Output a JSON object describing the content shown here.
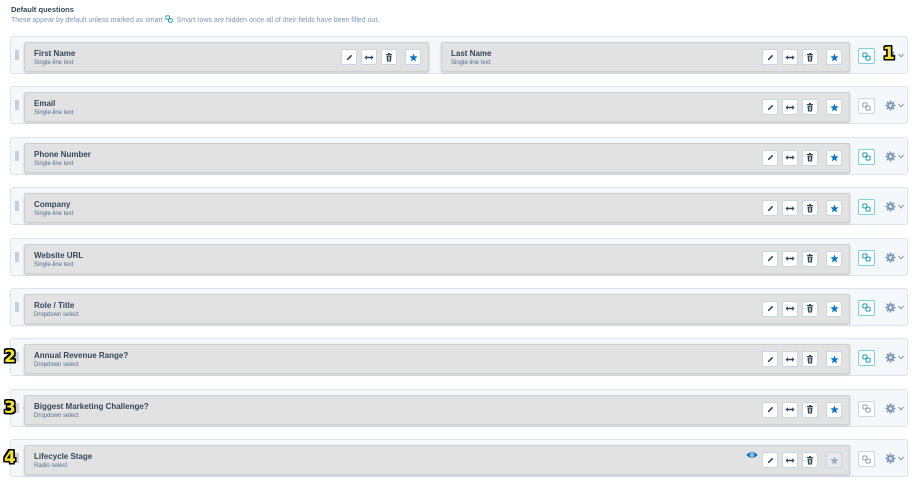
{
  "header": {
    "title": "Default questions",
    "desc_before": "These appear by default unless marked as smart",
    "desc_after": ". Smart rows are hidden once all of their fields have been filled out."
  },
  "colors": {
    "accent": "#0091ae",
    "star": "#0e76c8",
    "badge_fill": "#f5e12e"
  },
  "icons": {
    "edit": "pencil-icon",
    "width": "resize-arrows-icon",
    "delete": "trash-icon",
    "required": "star-icon",
    "smart": "smart-link-icon",
    "settings": "gear-icon",
    "dropdown": "chevron-down-icon",
    "visibility": "eye-icon"
  },
  "rows": [
    {
      "fields": [
        {
          "label": "First Name",
          "type": "Single-line text",
          "required": true,
          "star_enabled": true
        },
        {
          "label": "Last Name",
          "type": "Single-line text",
          "required": true,
          "star_enabled": true
        }
      ],
      "smart": true
    },
    {
      "fields": [
        {
          "label": "Email",
          "type": "Single-line text",
          "required": true,
          "star_enabled": true
        }
      ],
      "smart": false
    },
    {
      "fields": [
        {
          "label": "Phone Number",
          "type": "Single-line text",
          "required": true,
          "star_enabled": true
        }
      ],
      "smart": true
    },
    {
      "fields": [
        {
          "label": "Company",
          "type": "Single-line text",
          "required": true,
          "star_enabled": true
        }
      ],
      "smart": true
    },
    {
      "fields": [
        {
          "label": "Website URL",
          "type": "Single-line text",
          "required": true,
          "star_enabled": true
        }
      ],
      "smart": true
    },
    {
      "fields": [
        {
          "label": "Role / Title",
          "type": "Dropdown select",
          "required": true,
          "star_enabled": true
        }
      ],
      "smart": true
    },
    {
      "fields": [
        {
          "label": "Annual Revenue Range?",
          "type": "Dropdown select",
          "required": true,
          "star_enabled": true
        }
      ],
      "smart": true
    },
    {
      "fields": [
        {
          "label": "Biggest Marketing Challenge?",
          "type": "Dropdown select",
          "required": true,
          "star_enabled": true
        }
      ],
      "smart": false
    },
    {
      "fields": [
        {
          "label": "Lifecycle Stage",
          "type": "Radio select",
          "required": false,
          "star_enabled": false,
          "hidden_toggle": true
        }
      ],
      "smart": false
    }
  ],
  "badges": [
    {
      "text": "1",
      "row": 0
    },
    {
      "text": "2",
      "row": 6
    },
    {
      "text": "3",
      "row": 7
    },
    {
      "text": "4",
      "row": 8
    }
  ]
}
